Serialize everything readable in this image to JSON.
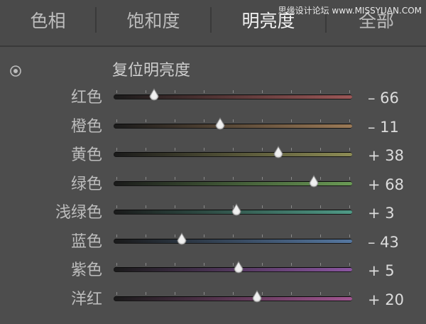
{
  "tabs": [
    {
      "label": "色相",
      "active": false
    },
    {
      "label": "饱和度",
      "active": false
    },
    {
      "label": "明亮度",
      "active": true
    },
    {
      "label": "全部",
      "active": false
    }
  ],
  "watermark": "思缘设计论坛 www.MISSYUAN.COM",
  "reset_label": "复位明亮度",
  "range": [
    -100,
    100
  ],
  "sliders": [
    {
      "label": "红色",
      "value": -66,
      "value_text": "– 66",
      "color": "#9b5757"
    },
    {
      "label": "橙色",
      "value": -11,
      "value_text": "– 11",
      "color": "#9b7a57"
    },
    {
      "label": "黄色",
      "value": 38,
      "value_text": "+ 38",
      "color": "#8d8c55"
    },
    {
      "label": "绿色",
      "value": 68,
      "value_text": "+ 68",
      "color": "#6a9a55"
    },
    {
      "label": "浅绿色",
      "value": 3,
      "value_text": "+ 3",
      "color": "#4f9a86"
    },
    {
      "label": "蓝色",
      "value": -43,
      "value_text": "– 43",
      "color": "#5577a0"
    },
    {
      "label": "紫色",
      "value": 5,
      "value_text": "+ 5",
      "color": "#8a55a0"
    },
    {
      "label": "洋红",
      "value": 20,
      "value_text": "+ 20",
      "color": "#a05590"
    }
  ]
}
